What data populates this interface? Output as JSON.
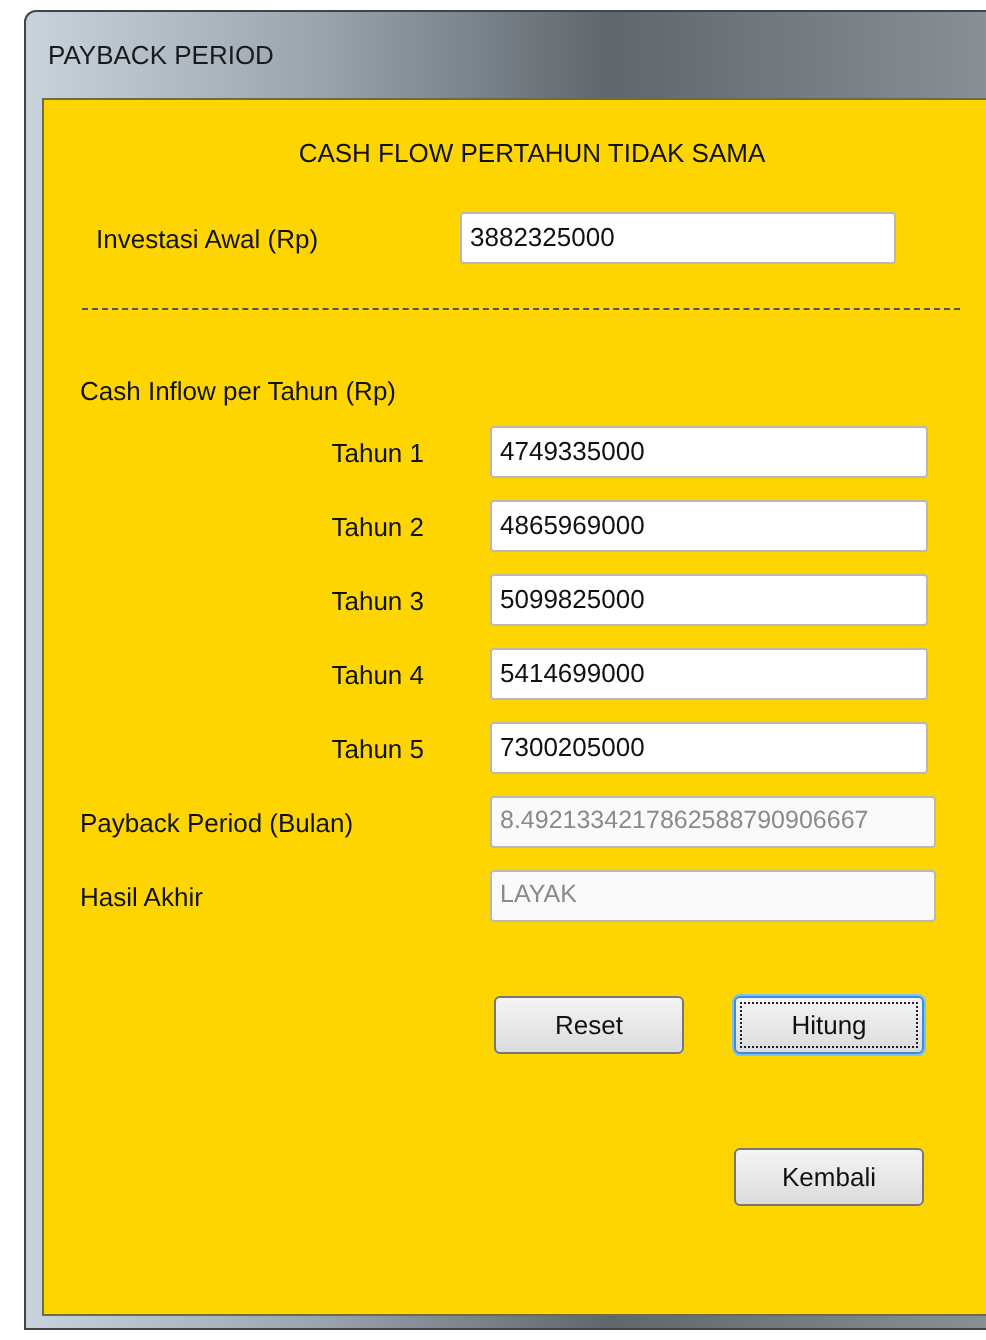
{
  "window": {
    "title": "PAYBACK PERIOD"
  },
  "heading": "CASH FLOW PERTAHUN TIDAK SAMA",
  "investment": {
    "label": "Investasi Awal (Rp)",
    "value": "3882325000",
    "disabled": false
  },
  "inflow_heading": "Cash Inflow per Tahun (Rp)",
  "years": [
    {
      "label": "Tahun 1",
      "value": "4749335000",
      "disabled": false
    },
    {
      "label": "Tahun 2",
      "value": "4865969000",
      "disabled": false
    },
    {
      "label": "Tahun 3",
      "value": "5099825000",
      "disabled": false
    },
    {
      "label": "Tahun 4",
      "value": "5414699000",
      "disabled": false
    },
    {
      "label": "Tahun 5",
      "value": "7300205000",
      "disabled": false
    }
  ],
  "results": [
    {
      "label": "Payback Period (Bulan)",
      "value": "8.4921334217862588790906667",
      "disabled": true
    },
    {
      "label": "Hasil Akhir",
      "value": "LAYAK",
      "disabled": true
    }
  ],
  "action_buttons": [
    {
      "label": "Reset",
      "focused": false
    },
    {
      "label": "Hitung",
      "focused": true
    }
  ],
  "back_button": {
    "label": "Kembali",
    "focused": false
  }
}
